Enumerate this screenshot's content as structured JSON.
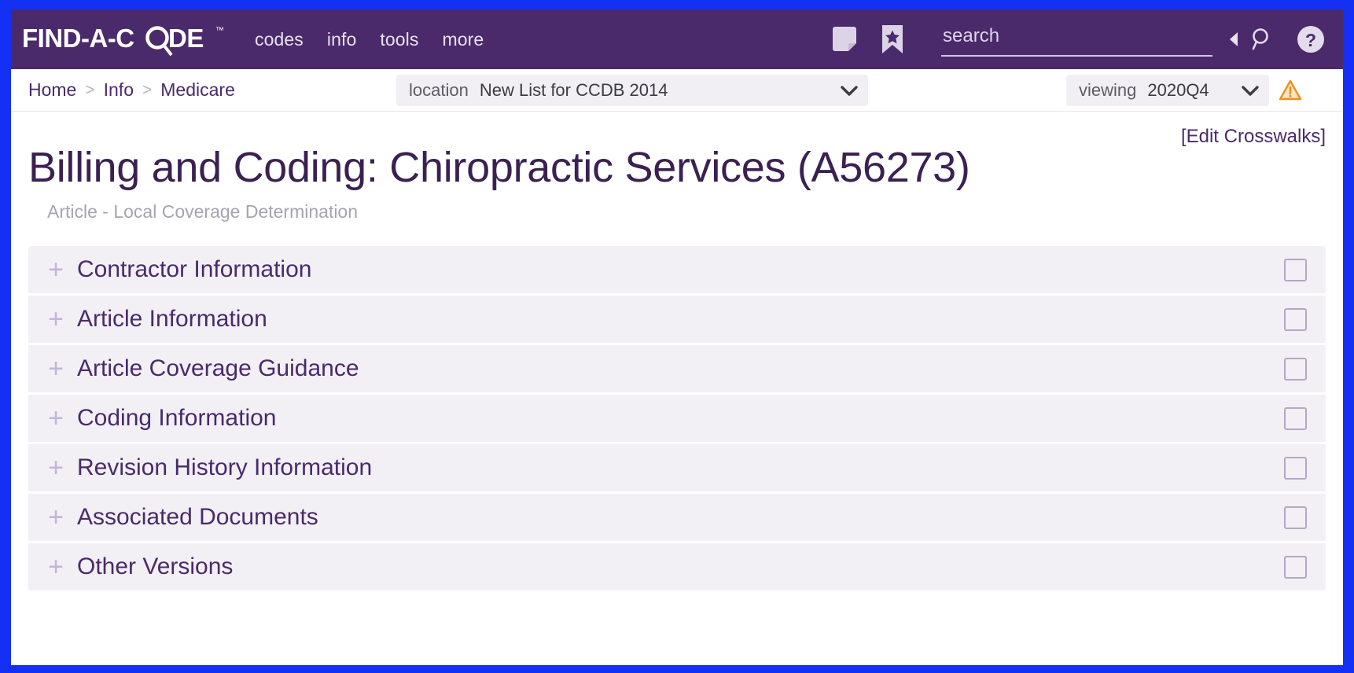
{
  "brand": {
    "logo_text": "FIND-A-CODE",
    "trademark": "™",
    "bar_color": "#4a2a6b",
    "frame_color": "#1430f5"
  },
  "topnav": {
    "items": [
      {
        "label": "codes"
      },
      {
        "label": "info"
      },
      {
        "label": "tools"
      },
      {
        "label": "more"
      }
    ],
    "note_icon": "note-icon",
    "bookmark_icon": "bookmark-star-icon",
    "collapse_icon": "caret-left-icon",
    "search_go_icon": "magnifier-icon",
    "help_icon": "help-circle-icon"
  },
  "search": {
    "placeholder": "search",
    "value": ""
  },
  "breadcrumb": {
    "items": [
      {
        "label": "Home"
      },
      {
        "label": "Info"
      },
      {
        "label": "Medicare"
      }
    ],
    "separator": ">"
  },
  "filters": {
    "location": {
      "label": "location",
      "value": "New List for CCDB 2014"
    },
    "viewing": {
      "label": "viewing",
      "value": "2020Q4"
    },
    "warning_icon": "warning-triangle-icon"
  },
  "main": {
    "edit_crosswalks": "[Edit Crosswalks]",
    "title": "Billing and Coding: Chiropractic Services (A56273)",
    "subtitle": "Article - Local Coverage Determination",
    "plus_glyph": "+",
    "sections": [
      {
        "label": "Contractor Information",
        "checked": false
      },
      {
        "label": "Article Information",
        "checked": false
      },
      {
        "label": "Article Coverage Guidance",
        "checked": false
      },
      {
        "label": "Coding Information",
        "checked": false
      },
      {
        "label": "Revision History Information",
        "checked": false
      },
      {
        "label": "Associated Documents",
        "checked": false
      },
      {
        "label": "Other Versions",
        "checked": false
      }
    ]
  },
  "colors": {
    "purple": "#4a2a6b",
    "title_purple": "#3b2152",
    "row_bg": "#f2f0f5",
    "plus_lavender": "#c3b5d4",
    "warning_orange": "#e8921f"
  }
}
